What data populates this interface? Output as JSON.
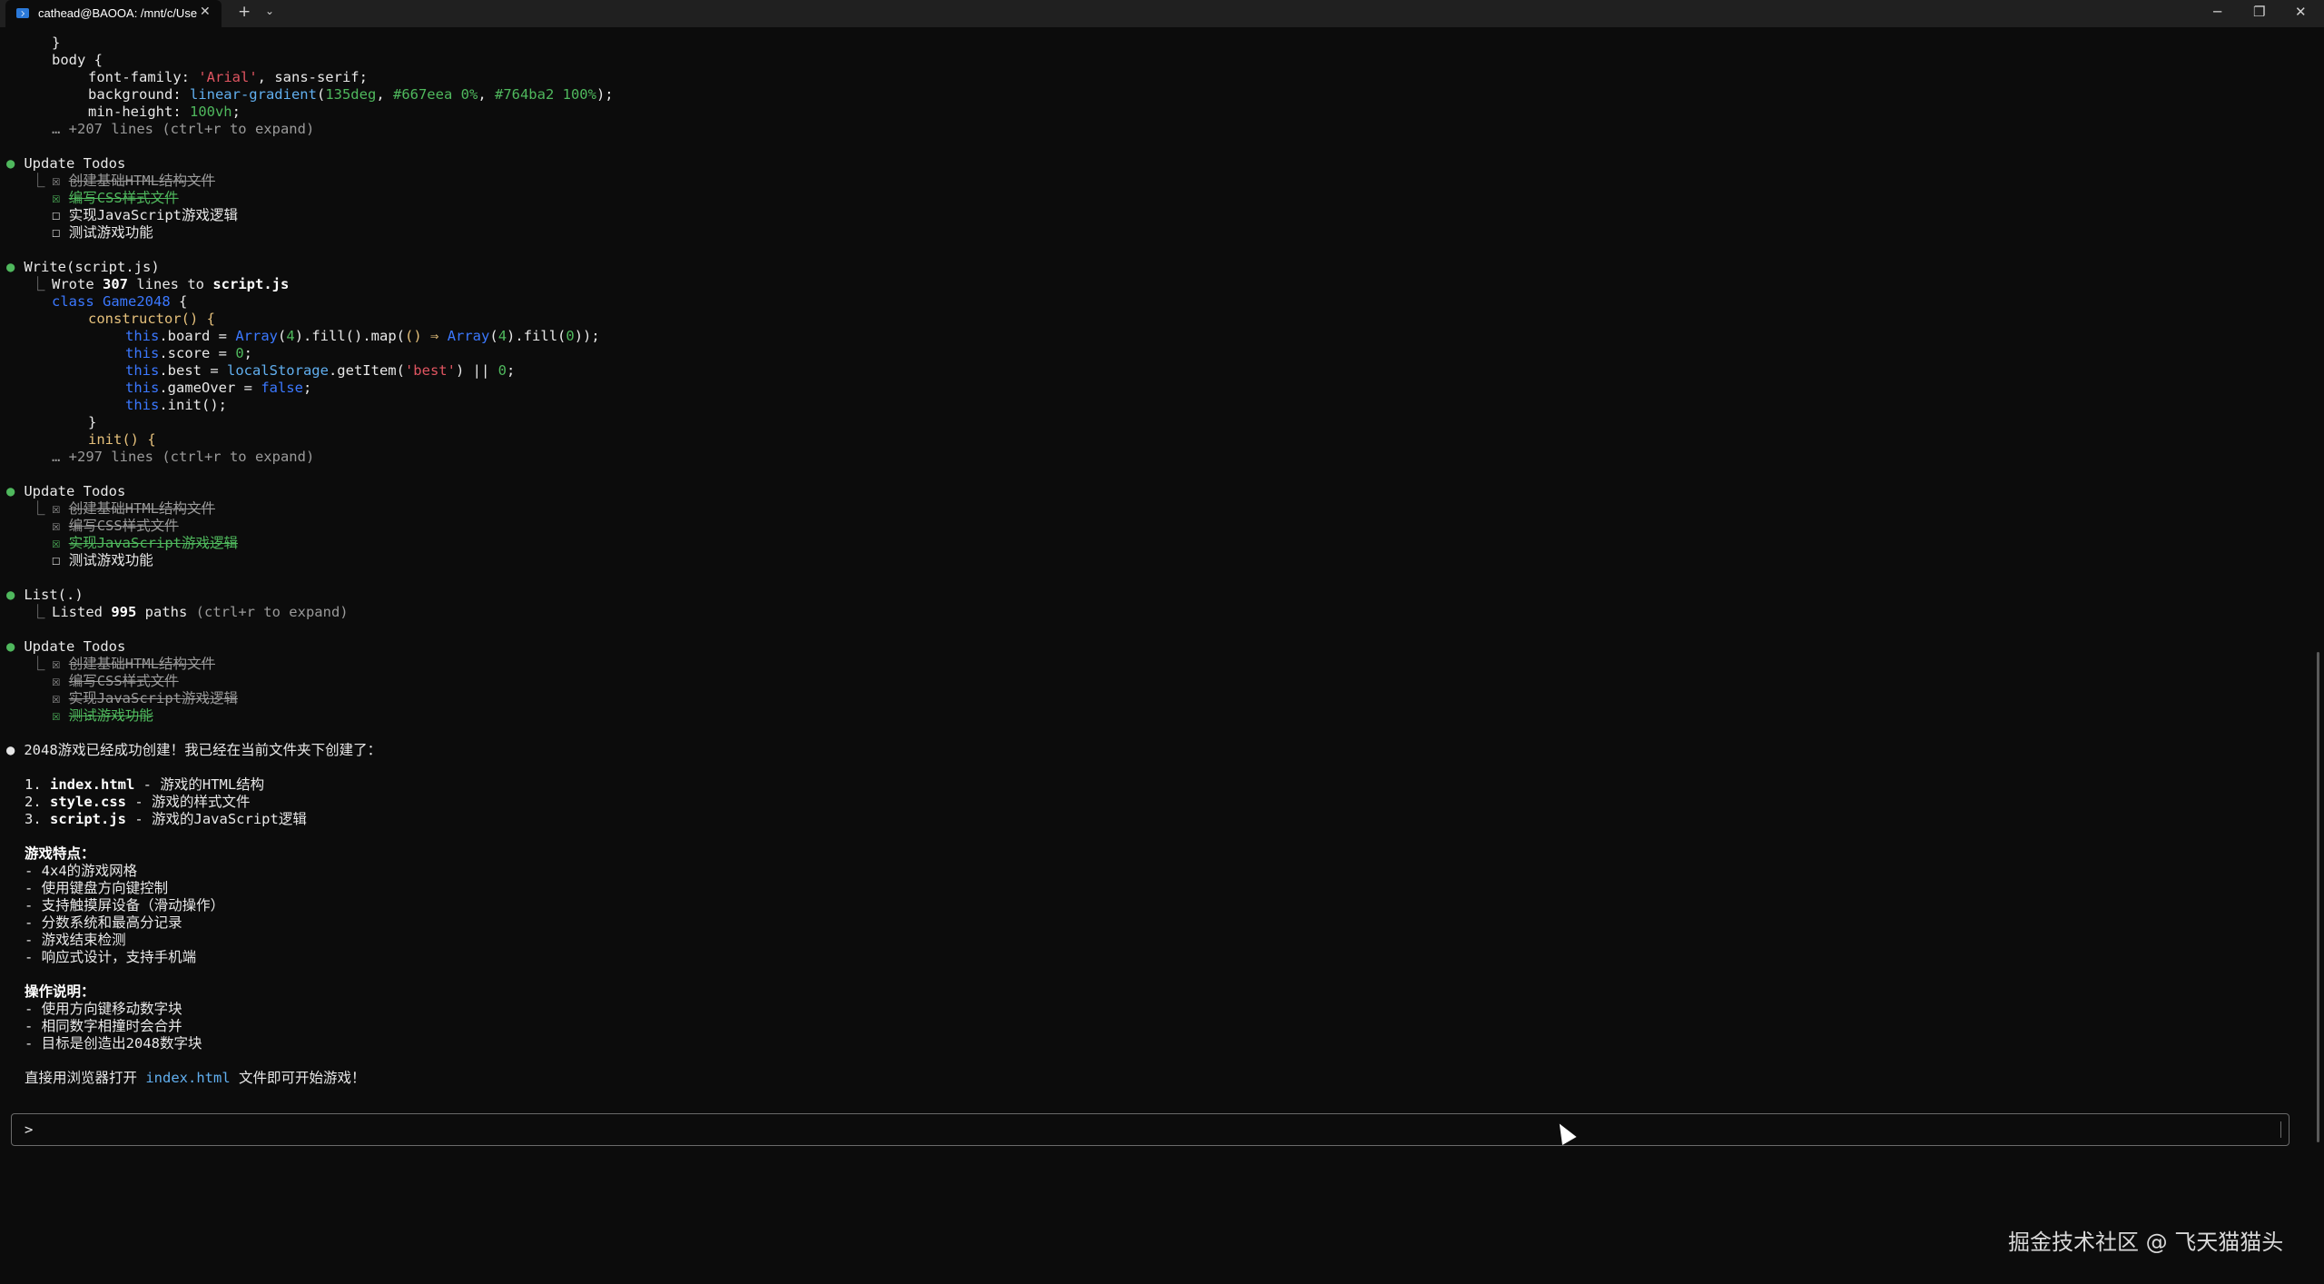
{
  "window": {
    "tab_title": "cathead@BAOOA: /mnt/c/Use",
    "tab_close": "✕",
    "new_tab": "+",
    "tab_dropdown": "⌄",
    "minimize": "─",
    "maximize": "❐",
    "close": "✕"
  },
  "css_tail": {
    "brace_close": "}",
    "body_open": "body {",
    "font_prop": "font-family: ",
    "font_val": "'Arial'",
    "font_rest": ", sans-serif;",
    "bg_prop": "background: ",
    "bg_fn": "linear-gradient",
    "bg_open": "(",
    "bg_deg": "135deg",
    "bg_sep1": ", ",
    "bg_c1": "#667eea 0%",
    "bg_sep2": ", ",
    "bg_c2": "#764ba2 100%",
    "bg_close": ");",
    "mh_prop": "min-height: ",
    "mh_val": "100vh",
    "mh_end": ";",
    "expand": "… +207 lines (ctrl+r to expand)"
  },
  "todos1": {
    "bullet": "●",
    "title": "Update Todos",
    "items": [
      {
        "box": "☒",
        "text": "创建基础HTML结构文件"
      },
      {
        "box": "☒",
        "text": "编写CSS样式文件"
      },
      {
        "box": "☐",
        "text": "实现JavaScript游戏逻辑"
      },
      {
        "box": "☐",
        "text": "测试游戏功能"
      }
    ]
  },
  "write": {
    "bullet": "●",
    "title": "Write",
    "arg": "(script.js)",
    "summary_pre": "Wrote ",
    "summary_num": "307",
    "summary_mid": " lines to ",
    "summary_file": "script.js",
    "code": {
      "l1_kw": "class",
      "l1_name": " Game2048",
      "l1_end": " {",
      "l2_fn": "constructor",
      "l2_end": "() {",
      "l3_this": "this",
      "l3_a": ".board = ",
      "l3_arr": "Array",
      "l3_b": "(",
      "l3_n1": "4",
      "l3_c": ").fill().map(",
      "l3_arrow": "() ⇒ ",
      "l3_arr2": "Array",
      "l3_d": "(",
      "l3_n2": "4",
      "l3_e": ").fill(",
      "l3_n3": "0",
      "l3_f": "));",
      "l4_this": "this",
      "l4_a": ".score = ",
      "l4_n": "0",
      "l4_end": ";",
      "l5_this": "this",
      "l5_a": ".best = ",
      "l5_ls": "localStorage",
      "l5_b": ".getItem(",
      "l5_str": "'best'",
      "l5_c": ") || ",
      "l5_n": "0",
      "l5_end": ";",
      "l6_this": "this",
      "l6_a": ".gameOver = ",
      "l6_val": "false",
      "l6_end": ";",
      "l7_this": "this",
      "l7_a": ".init();",
      "l8": "}",
      "l9_fn": "init",
      "l9_end": "() {"
    },
    "expand": "… +297 lines (ctrl+r to expand)"
  },
  "todos2": {
    "bullet": "●",
    "title": "Update Todos",
    "items": [
      {
        "box": "☒",
        "text": "创建基础HTML结构文件"
      },
      {
        "box": "☒",
        "text": "编写CSS样式文件"
      },
      {
        "box": "☒",
        "text": "实现JavaScript游戏逻辑"
      },
      {
        "box": "☐",
        "text": "测试游戏功能"
      }
    ]
  },
  "list": {
    "bullet": "●",
    "title": "List",
    "arg": "(.)",
    "summary_pre": "Listed ",
    "summary_num": "995",
    "summary_mid": " paths ",
    "summary_hint": "(ctrl+r to expand)"
  },
  "todos3": {
    "bullet": "●",
    "title": "Update Todos",
    "items": [
      {
        "box": "☒",
        "text": "创建基础HTML结构文件"
      },
      {
        "box": "☒",
        "text": "编写CSS样式文件"
      },
      {
        "box": "☒",
        "text": "实现JavaScript游戏逻辑"
      },
      {
        "box": "☒",
        "text": "测试游戏功能"
      }
    ]
  },
  "tree_glyph": "⎿",
  "result": {
    "bullet": "●",
    "intro": "2048游戏已经成功创建！我已经在当前文件夹下创建了：",
    "files": [
      {
        "num": "1. ",
        "name": "index.html",
        "desc": " - 游戏的HTML结构"
      },
      {
        "num": "2. ",
        "name": "style.css",
        "desc": " - 游戏的样式文件"
      },
      {
        "num": "3. ",
        "name": "script.js",
        "desc": " - 游戏的JavaScript逻辑"
      }
    ],
    "features_title": "游戏特点：",
    "features": [
      "- 4x4的游戏网格",
      "- 使用键盘方向键控制",
      "- 支持触摸屏设备（滑动操作）",
      "- 分数系统和最高分记录",
      "- 游戏结束检测",
      "- 响应式设计，支持手机端"
    ],
    "ops_title": "操作说明：",
    "ops": [
      "- 使用方向键移动数字块",
      "- 相同数字相撞时会合并",
      "- 目标是创造出2048数字块"
    ],
    "closing_pre": "直接用浏览器打开 ",
    "closing_file": "index.html",
    "closing_post": " 文件即可开始游戏！"
  },
  "prompt": {
    "char": ">"
  },
  "watermark": "掘金技术社区 @ 飞天猫猫头"
}
